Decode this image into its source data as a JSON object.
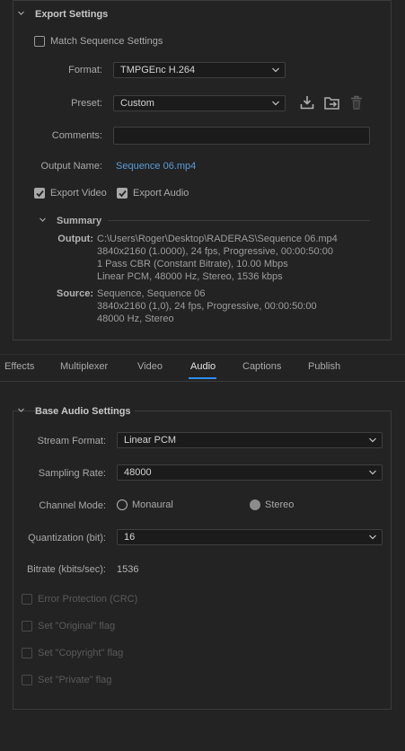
{
  "export_settings": {
    "title": "Export Settings",
    "match_sequence_label": "Match Sequence Settings",
    "format_label": "Format:",
    "format_value": "TMPGEnc H.264",
    "preset_label": "Preset:",
    "preset_value": "Custom",
    "comments_label": "Comments:",
    "comments_value": "",
    "output_name_label": "Output Name:",
    "output_name_value": "Sequence 06.mp4",
    "export_video_label": "Export Video",
    "export_audio_label": "Export Audio",
    "summary_title": "Summary",
    "summary": {
      "output_key": "Output:",
      "output_lines": [
        "C:\\Users\\Roger\\Desktop\\RADERAS\\Sequence 06.mp4",
        "3840x2160 (1.0000), 24 fps, Progressive, 00:00:50:00",
        "1 Pass CBR (Constant Bitrate), 10.00 Mbps",
        "Linear PCM, 48000 Hz, Stereo, 1536 kbps"
      ],
      "source_key": "Source:",
      "source_lines": [
        "Sequence, Sequence 06",
        "3840x2160 (1,0), 24 fps, Progressive, 00:00:50:00",
        "48000 Hz, Stereo"
      ]
    }
  },
  "tabs": [
    "Effects",
    "Multiplexer",
    "Video",
    "Audio",
    "Captions",
    "Publish"
  ],
  "active_tab": "Audio",
  "audio": {
    "title": "Base Audio Settings",
    "stream_format_label": "Stream Format:",
    "stream_format_value": "Linear PCM",
    "sampling_rate_label": "Sampling Rate:",
    "sampling_rate_value": "48000",
    "channel_mode_label": "Channel Mode:",
    "channel_monaural": "Monaural",
    "channel_stereo": "Stereo",
    "quantization_label": "Quantization (bit):",
    "quantization_value": "16",
    "bitrate_label": "Bitrate (kbits/sec):",
    "bitrate_value": "1536",
    "error_protection": "Error Protection (CRC)",
    "original_flag": "Set \"Original\" flag",
    "copyright_flag": "Set \"Copyright\" flag",
    "private_flag": "Set \"Private\" flag"
  },
  "colors": {
    "background": "#232323",
    "link": "#5b9bd5",
    "active_tab_underline": "#2d8ceb"
  }
}
